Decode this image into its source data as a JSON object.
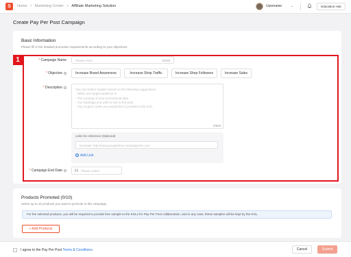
{
  "topbar": {
    "logo_glyph": "S",
    "breadcrumbs": [
      "Home",
      "Marketing Center",
      "Affiliate Marketing Solution"
    ],
    "username": "Username",
    "chevron": "⌄",
    "bell": "🔔",
    "education_hub": "Education Hub"
  },
  "page": {
    "title": "Create Pay Per Post Campaign"
  },
  "basic_info": {
    "title": "Basic Information",
    "subtitle": "Please fill in the detailed promotion requirements according to your objectives."
  },
  "annotation": {
    "number": "1",
    "color": "#e2141d"
  },
  "form": {
    "campaign_name": {
      "label": "Campaign Name",
      "placeholder": "Please enter",
      "counter": "0/100"
    },
    "objective": {
      "label": "Objective",
      "options": [
        "Increase Brand Awareness",
        "Increase Shop Traffic",
        "Increase Shop Followers",
        "Increase Sales"
      ]
    },
    "description": {
      "label": "Description",
      "placeholder_lines": [
        "You can further explain based on the following suggestions:",
        "· What your target audience is",
        "· The concept of your promotional idea",
        "· Any hashtags you wish to use in the post",
        "· Any coupon codes you would like to provide to the KOL"
      ],
      "counter": "0/500"
    },
    "links": {
      "label": "Links for reference  (Optional)",
      "placeholder": "Example: http://www.googledrive.campaigninfo.com",
      "add_link": "Add Link"
    },
    "end_date": {
      "label": "Campaign End Date",
      "placeholder": "Please select"
    }
  },
  "products": {
    "title": "Products Promoted (0/10)",
    "subtitle": "Select up to 10 products you want to promote in this campaign.",
    "notice": "For the selected products, you will be required to provide free sample to the KOLs for Pay Per Post collaboration, and in any case, these samples will be kept by the KOL.",
    "add_button": "+ Add Products"
  },
  "footer": {
    "agree_text": "I agree to the Pay Per Post ",
    "terms_link": "Terms & Conditions",
    "terms_end": ".",
    "cancel": "Cancel",
    "submit": "Submit"
  },
  "colors": {
    "brand": "#ee4d2d",
    "link": "#2673dd",
    "highlight": "#e2141d"
  }
}
